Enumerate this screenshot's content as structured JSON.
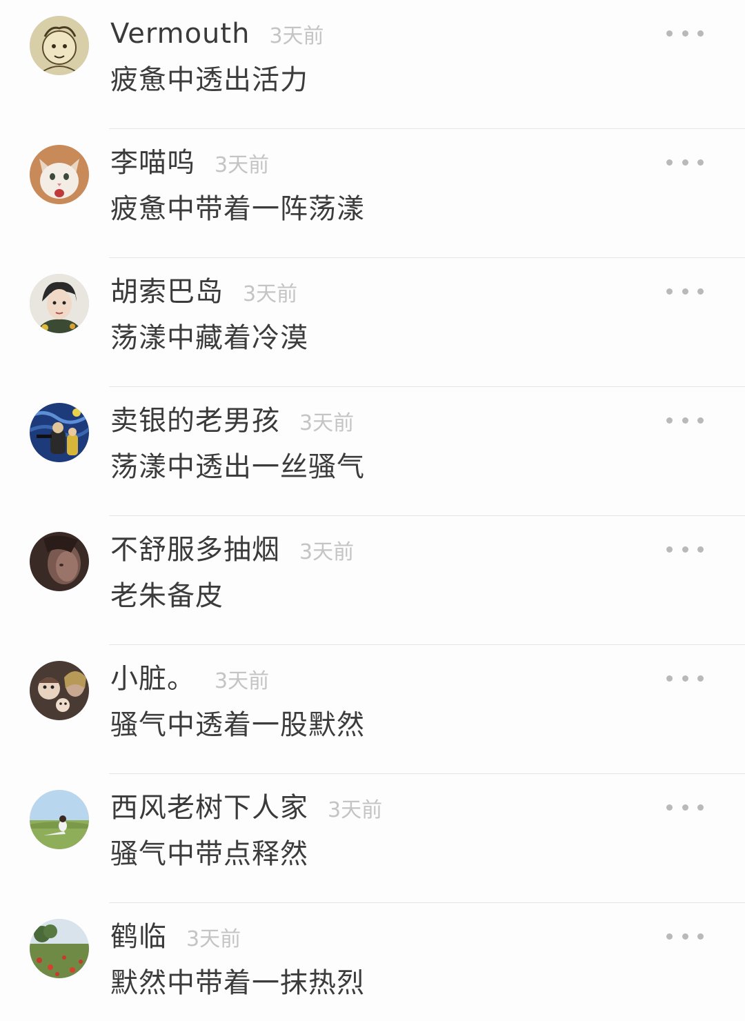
{
  "comments": [
    {
      "name": "Vermouth",
      "time": "3天前",
      "text": "疲惫中透出活力",
      "avatar": "sketch-face-avatar"
    },
    {
      "name": "李喵呜",
      "time": "3天前",
      "text": "疲惫中带着一阵荡漾",
      "avatar": "cat-avatar"
    },
    {
      "name": "胡索巴岛",
      "time": "3天前",
      "text": "荡漾中藏着冷漠",
      "avatar": "portrait-avatar"
    },
    {
      "name": "卖银的老男孩",
      "time": "3天前",
      "text": "荡漾中透出一丝骚气",
      "avatar": "starry-night-avatar"
    },
    {
      "name": "不舒服多抽烟",
      "time": "3天前",
      "text": "老朱备皮",
      "avatar": "dark-face-avatar"
    },
    {
      "name": "小脏。",
      "time": "3天前",
      "text": "骚气中透着一股默然",
      "avatar": "dolls-avatar"
    },
    {
      "name": "西风老树下人家",
      "time": "3天前",
      "text": "骚气中带点释然",
      "avatar": "field-avatar"
    },
    {
      "name": "鹤临",
      "time": "3天前",
      "text": "默然中带着一抹热烈",
      "avatar": "poppy-field-avatar"
    }
  ],
  "colors": {
    "name": "#3a3a3a",
    "time": "#c4c4c4",
    "content": "#3c3c3c",
    "divider": "#e6e6e6",
    "more_dots": "#b9b9b9"
  }
}
